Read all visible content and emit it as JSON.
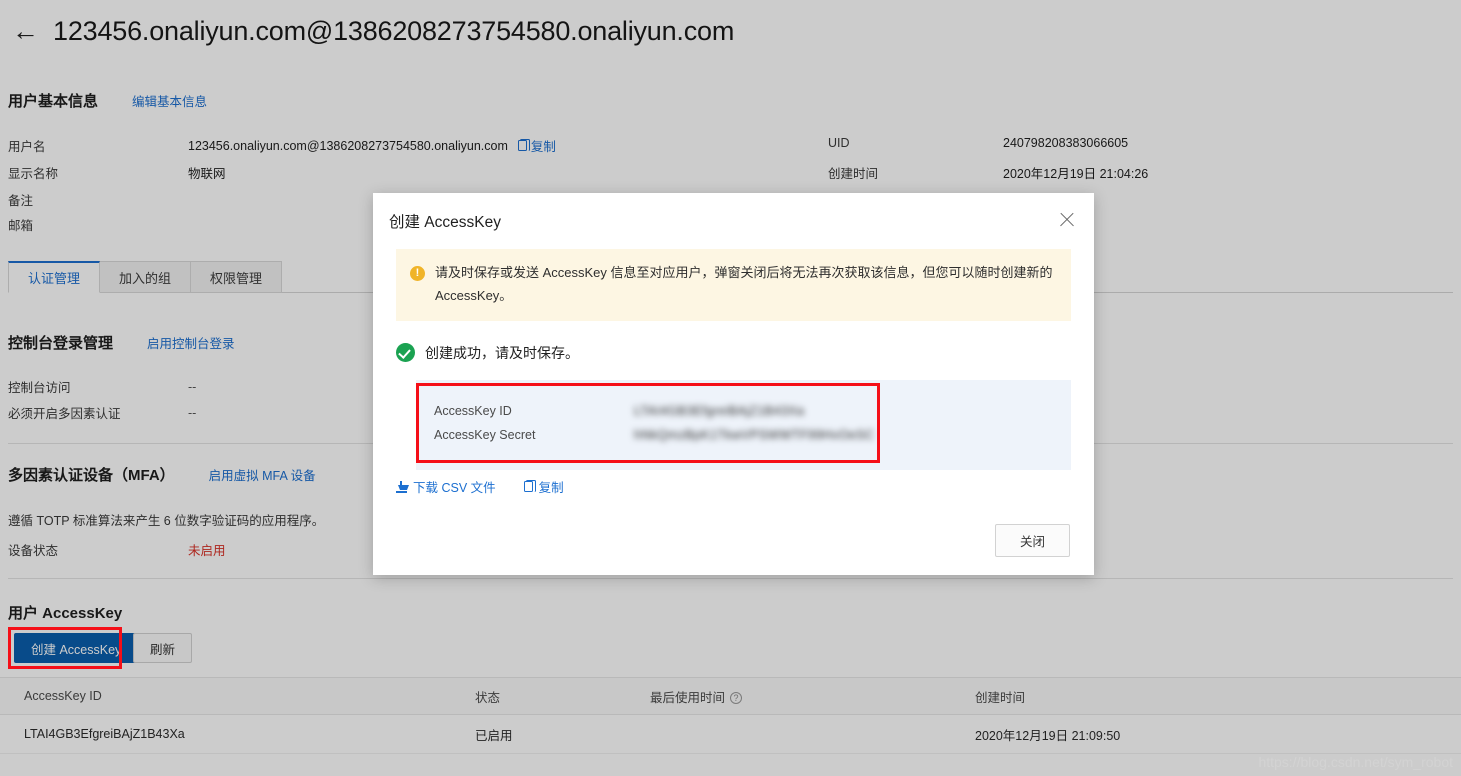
{
  "header": {
    "back_icon": "back-arrow-icon",
    "title": "123456.onaliyun.com@1386208273754580.onaliyun.com"
  },
  "basic_info": {
    "section_title": "用户基本信息",
    "edit_link": "编辑基本信息",
    "left_rows": [
      {
        "label": "用户名",
        "value": "123456.onaliyun.com@1386208273754580.onaliyun.com",
        "copy_label": "复制"
      },
      {
        "label": "显示名称",
        "value": "物联网"
      },
      {
        "label": "备注",
        "value": ""
      },
      {
        "label": "邮箱",
        "value": ""
      }
    ],
    "right_rows": [
      {
        "label": "UID",
        "value": "240798208383066605"
      },
      {
        "label": "创建时间",
        "value": "2020年12月19日 21:04:26"
      }
    ]
  },
  "tabs": [
    {
      "label": "认证管理",
      "active": true
    },
    {
      "label": "加入的组",
      "active": false
    },
    {
      "label": "权限管理",
      "active": false
    }
  ],
  "console_login": {
    "section_title": "控制台登录管理",
    "action_link": "启用控制台登录",
    "rows": [
      {
        "label": "控制台访问",
        "value": "--"
      },
      {
        "label": "必须开启多因素认证",
        "value": "--"
      }
    ]
  },
  "mfa": {
    "section_title": "多因素认证设备（MFA）",
    "action_link": "启用虚拟 MFA 设备",
    "description": "遵循 TOTP 标准算法来产生 6 位数字验证码的应用程序。",
    "status_label": "设备状态",
    "status_value": "未启用"
  },
  "access_key_section": {
    "section_title": "用户 AccessKey",
    "create_button": "创建 AccessKey",
    "refresh_button": "刷新",
    "table": {
      "columns": [
        "AccessKey ID",
        "状态",
        "最后使用时间",
        "创建时间"
      ],
      "help_icon_column": "最后使用时间",
      "rows": [
        {
          "access_key_id": "LTAI4GB3EfgreiBAjZ1B43Xa",
          "status": "已启用",
          "last_used": "",
          "created_at": "2020年12月19日 21:09:50"
        }
      ]
    }
  },
  "modal": {
    "title": "创建 AccessKey",
    "close_icon": "close-icon",
    "warning_icon": "warning-icon",
    "warning_text": "请及时保存或发送 AccessKey 信息至对应用户，弹窗关闭后将无法再次获取该信息，但您可以随时创建新的 AccessKey。",
    "success_icon": "success-check-icon",
    "success_text": "创建成功，请及时保存。",
    "credentials": [
      {
        "label": "AccessKey ID",
        "value": "LTAI4GB3EfgreiBAjZ1B43Xa"
      },
      {
        "label": "AccessKey Secret",
        "value": "hNkQmzBpK1TkwVPSWWTF99HvOeSC"
      }
    ],
    "download_link": "下载 CSV 文件",
    "copy_link": "复制",
    "close_button": "关闭"
  },
  "watermark": "https://blog.csdn.net/sym_robot",
  "colors": {
    "accent": "#1c6fd0",
    "primary_button": "#0b5ead",
    "danger": "#d93026",
    "annotation": "#f50f18",
    "success": "#1aa251",
    "warning": "#f0b429"
  }
}
